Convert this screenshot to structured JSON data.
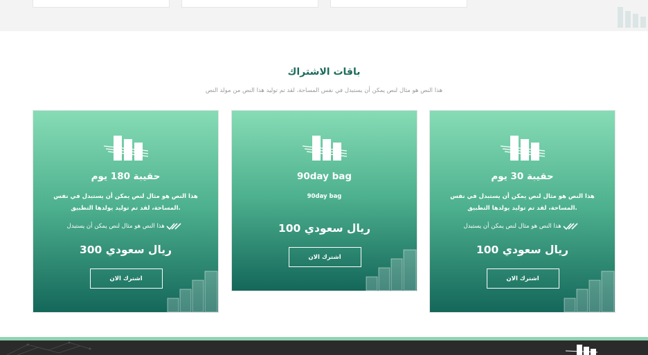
{
  "colors": {
    "accent": "#1c6b5a",
    "card_top": "#86dcb5",
    "card_bottom": "#14675a",
    "footer": "#2b2b2b",
    "footer_line": "#8fd3b2"
  },
  "section": {
    "title": "باقات الاشتراك",
    "subtitle": "هذا النص هو مثال لنص يمكن أن يستبدل في نفس المساحة، لقد تم توليد هذا النص من مولد النص"
  },
  "plans": [
    {
      "title": "حقيبة 180 يوم",
      "description": "هذا النص هو مثال لنص يمكن أن يستبدل في نفس المساحة، لقد تم توليد يولدها التطبيق.",
      "feature": "هذا النص هو مثال لنص يمكن أن يستبدل",
      "price": "300 ريال سعودي",
      "button": "اشترك الان",
      "icon": "bars-logo-icon"
    },
    {
      "title": "90day bag",
      "description": "90day bag",
      "price": "100 ريال سعودي",
      "button": "اشترك الان",
      "icon": "bars-logo-icon"
    },
    {
      "title": "حقيبة 30 يوم",
      "description": "هذا النص هو مثال لنص يمكن أن يستبدل في نفس المساحة، لقد تم توليد يولدها التطبيق.",
      "feature": "هذا النص هو مثال لنص يمكن أن يستبدل",
      "price": "100 ريال سعودي",
      "button": "اشترك الان",
      "icon": "bars-logo-icon"
    }
  ]
}
